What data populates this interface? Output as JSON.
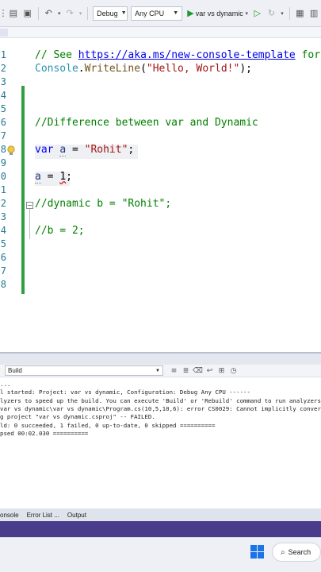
{
  "toolbar": {
    "config": "Debug",
    "platform": "Any CPU",
    "run_target": "var vs dynamic"
  },
  "editor": {
    "lines": [
      {
        "n": "1",
        "parts": [
          {
            "t": "// See ",
            "c": "cmt"
          },
          {
            "t": "https://aka.ms/new-console-template",
            "c": "link"
          },
          {
            "t": " for m",
            "c": "cmt"
          }
        ]
      },
      {
        "n": "2",
        "parts": [
          {
            "t": "Console",
            "c": "cls"
          },
          {
            "t": ".",
            "c": ""
          },
          {
            "t": "WriteLine",
            "c": "fn"
          },
          {
            "t": "(",
            "c": ""
          },
          {
            "t": "\"Hello, World!\"",
            "c": "str"
          },
          {
            "t": ");",
            "c": ""
          }
        ]
      },
      {
        "n": "3",
        "parts": []
      },
      {
        "n": "4",
        "parts": []
      },
      {
        "n": "5",
        "parts": []
      },
      {
        "n": "6",
        "parts": [
          {
            "t": "//Difference between var and Dynamic",
            "c": "cmt"
          }
        ]
      },
      {
        "n": "7",
        "parts": []
      },
      {
        "n": "8",
        "parts": [
          {
            "t": "var",
            "c": "kw"
          },
          {
            "t": " ",
            "c": ""
          },
          {
            "t": "a",
            "c": "var dotted"
          },
          {
            "t": " = ",
            "c": ""
          },
          {
            "t": "\"Rohit\"",
            "c": "str"
          },
          {
            "t": ";",
            "c": ""
          }
        ]
      },
      {
        "n": "9",
        "parts": []
      },
      {
        "n": "0",
        "parts": [
          {
            "t": "a",
            "c": "var dotted"
          },
          {
            "t": " = ",
            "c": ""
          },
          {
            "t": "1",
            "c": "squiggle"
          },
          {
            "t": ";",
            "c": ""
          }
        ]
      },
      {
        "n": "1",
        "parts": []
      },
      {
        "n": "2",
        "parts": [
          {
            "t": "//dynamic b = \"Rohit\";",
            "c": "cmt"
          }
        ]
      },
      {
        "n": "3",
        "parts": []
      },
      {
        "n": "4",
        "parts": [
          {
            "t": "//b = 2;",
            "c": "cmt"
          }
        ]
      },
      {
        "n": "5",
        "parts": []
      },
      {
        "n": "6",
        "parts": []
      },
      {
        "n": "7",
        "parts": []
      },
      {
        "n": "8",
        "parts": []
      }
    ]
  },
  "output": {
    "source": "Build",
    "lines": [
      "...",
      "l started: Project: var vs dynamic, Configuration: Debug Any CPU ------",
      "lyzers to speed up the build. You can execute 'Build' or 'Rebuild' command to run analyzers",
      " var vs dynamic\\var vs dynamic\\Program.cs(10,5,10,6): error CS0029: Cannot implicitly conver",
      "g project \"var vs dynamic.csproj\" -- FAILED.",
      "ld: 0 succeeded, 1 failed, 0 up-to-date, 0 skipped ==========",
      "psed 00:02.030 =========="
    ]
  },
  "bottom_tabs": [
    "onsole",
    "Error List ...",
    "Output"
  ],
  "taskbar": {
    "search_label": "Search"
  }
}
